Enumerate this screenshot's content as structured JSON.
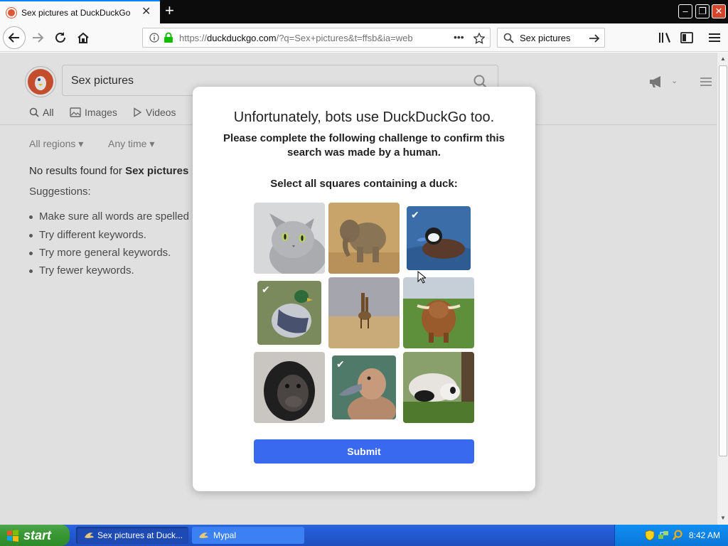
{
  "browser": {
    "tab_title": "Sex pictures at DuckDuckGo",
    "url_prefix": "https://",
    "url_host": "duckduckgo.com",
    "url_path": "/?q=Sex+pictures&t=ffsb&ia=web",
    "search_value": "Sex pictures",
    "url_more": "•••"
  },
  "ddg": {
    "search_value": "Sex pictures",
    "tabs": {
      "all": "All",
      "images": "Images",
      "videos": "Videos"
    },
    "filters": {
      "region": "All regions ▾",
      "time": "Any time ▾"
    },
    "no_results_prefix": "No results found for ",
    "no_results_query": "Sex pictures",
    "suggestions_label": "Suggestions:",
    "suggestions": [
      "Make sure all words are spelled",
      "Try different keywords.",
      "Try more general keywords.",
      "Try fewer keywords."
    ]
  },
  "modal": {
    "title": "Unfortunately, bots use DuckDuckGo too.",
    "subtitle": "Please complete the following challenge to confirm this search was made by a human.",
    "prompt": "Select all squares containing a duck:",
    "tiles": [
      {
        "subject": "cat",
        "selected": false
      },
      {
        "subject": "elephant",
        "selected": false
      },
      {
        "subject": "duck",
        "selected": true
      },
      {
        "subject": "duck",
        "selected": true
      },
      {
        "subject": "giraffe",
        "selected": false
      },
      {
        "subject": "highland-cow",
        "selected": false
      },
      {
        "subject": "chimpanzee",
        "selected": false
      },
      {
        "subject": "duck",
        "selected": true
      },
      {
        "subject": "panda",
        "selected": false
      }
    ],
    "submit_label": "Submit"
  },
  "taskbar": {
    "start_label": "start",
    "tasks": [
      "Sex pictures at Duck...",
      "Mypal"
    ],
    "clock": "8:42 AM"
  },
  "colors": {
    "accent_blue": "#3969ef",
    "ddg_orange": "#de5833",
    "xp_blue": "#245edb",
    "start_green": "#379632"
  }
}
